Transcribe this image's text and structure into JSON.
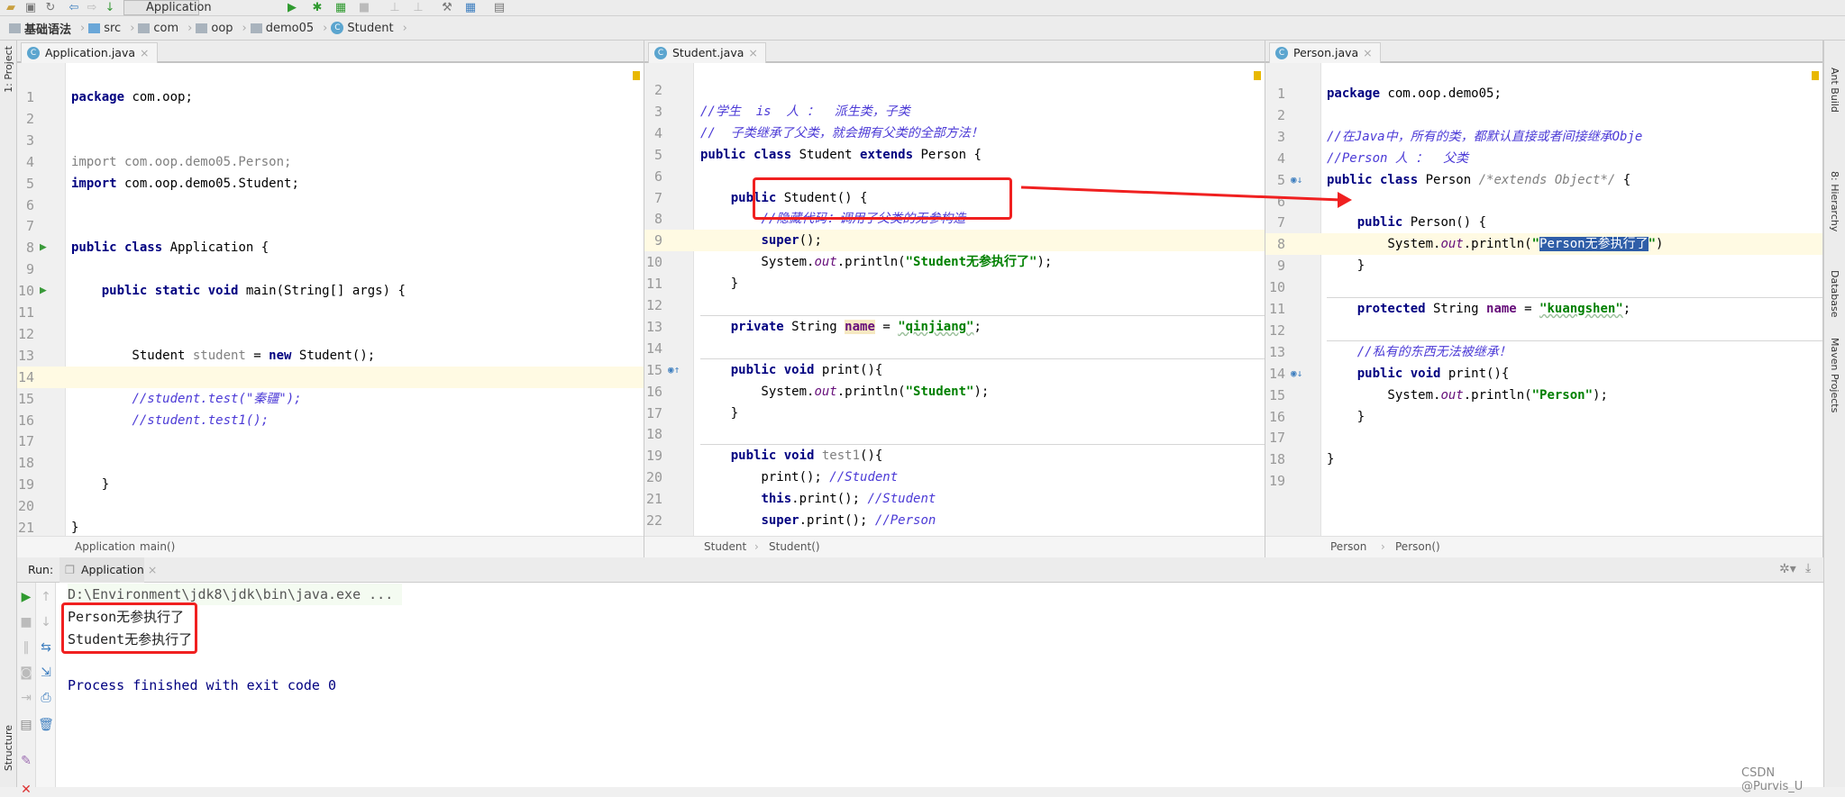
{
  "toolbar": {
    "run_config": "Application"
  },
  "breadcrumb": [
    "基础语法",
    "src",
    "com",
    "oop",
    "demo05",
    "Student"
  ],
  "left_strip": {
    "project": "1: Project",
    "structure": "Structure"
  },
  "right_strip": [
    "Ant Build",
    "8: Hierarchy",
    "Database",
    "Maven Projects"
  ],
  "panes": [
    {
      "tab": "Application.java",
      "start": 1,
      "current_line": 14,
      "footer": [
        "Application",
        "main()"
      ],
      "lines": [
        [
          [
            "k",
            "package"
          ],
          [
            "p",
            " com.oop;"
          ]
        ],
        [],
        [],
        [
          [
            "u",
            "import com.oop.demo05.Person;"
          ]
        ],
        [
          [
            "k",
            "import"
          ],
          [
            "p",
            " com.oop.demo05.Student;"
          ]
        ],
        [],
        [],
        [
          [
            "k",
            "public class"
          ],
          [
            "p",
            " Application {"
          ]
        ],
        [],
        [
          [
            "p",
            "    "
          ],
          [
            "k",
            "public static void"
          ],
          [
            "p",
            " main(String[] args) {"
          ]
        ],
        [],
        [],
        [
          [
            "p",
            "        Student "
          ],
          [
            "u",
            "student"
          ],
          [
            "p",
            " = "
          ],
          [
            "k",
            "new"
          ],
          [
            "p",
            " Student();"
          ]
        ],
        [],
        [
          [
            "p",
            "        "
          ],
          [
            "c",
            "//student.test(\"秦疆\");"
          ]
        ],
        [
          [
            "p",
            "        "
          ],
          [
            "c",
            "//student.test1();"
          ]
        ],
        [],
        [],
        [
          [
            "p",
            "    }"
          ]
        ],
        [],
        [
          [
            "p",
            "}"
          ]
        ]
      ]
    },
    {
      "tab": "Student.java",
      "start": 2,
      "current_line": 9,
      "footer": [
        "Student",
        "Student()"
      ],
      "lines": [
        [],
        [
          [
            "c",
            "//学生  is  人 ：  派生类，子类"
          ]
        ],
        [
          [
            "c",
            "//  子类继承了父类，就会拥有父类的全部方法！"
          ]
        ],
        [
          [
            "k",
            "public class"
          ],
          [
            "p",
            " Student "
          ],
          [
            "k",
            "extends"
          ],
          [
            "p",
            " Person {"
          ]
        ],
        [],
        [
          [
            "p",
            "    "
          ],
          [
            "k",
            "public"
          ],
          [
            "p",
            " Student() {"
          ]
        ],
        [
          [
            "p",
            "        "
          ],
          [
            "c",
            "//隐藏代码：调用了父类的无参构造"
          ]
        ],
        [
          [
            "p",
            "        "
          ],
          [
            "k",
            "super"
          ],
          [
            "p",
            "();"
          ]
        ],
        [
          [
            "p",
            "        System."
          ],
          [
            "o",
            "out"
          ],
          [
            "p",
            ".println("
          ],
          [
            "s",
            "\"Student无参执行了\""
          ],
          [
            "p",
            ");"
          ]
        ],
        [
          [
            "p",
            "    }"
          ]
        ],
        [],
        [
          [
            "p",
            "    "
          ],
          [
            "k",
            "private"
          ],
          [
            "p",
            " String "
          ],
          [
            "f hl",
            "name"
          ],
          [
            "p",
            " = "
          ],
          [
            "s",
            "\"qinjiang\""
          ],
          [
            "p",
            ";"
          ]
        ],
        [],
        [
          [
            "p",
            "    "
          ],
          [
            "k",
            "public void"
          ],
          [
            "p",
            " print(){"
          ]
        ],
        [
          [
            "p",
            "        System."
          ],
          [
            "o",
            "out"
          ],
          [
            "p",
            ".println("
          ],
          [
            "s",
            "\"Student\""
          ],
          [
            "p",
            ");"
          ]
        ],
        [
          [
            "p",
            "    }"
          ]
        ],
        [],
        [
          [
            "p",
            "    "
          ],
          [
            "k",
            "public void"
          ],
          [
            "u",
            " test1"
          ],
          [
            "p",
            "(){"
          ]
        ],
        [
          [
            "p",
            "        print(); "
          ],
          [
            "c",
            "//Student"
          ]
        ],
        [
          [
            "p",
            "        "
          ],
          [
            "k",
            "this"
          ],
          [
            "p",
            ".print(); "
          ],
          [
            "c",
            "//Student"
          ]
        ],
        [
          [
            "p",
            "        "
          ],
          [
            "k",
            "super"
          ],
          [
            "p",
            ".print(); "
          ],
          [
            "c",
            "//Person"
          ]
        ]
      ]
    },
    {
      "tab": "Person.java",
      "start": 1,
      "current_line": 8,
      "footer": [
        "Person",
        "Person()"
      ],
      "lines": [
        [
          [
            "k",
            "package"
          ],
          [
            "p",
            " com.oop.demo05;"
          ]
        ],
        [],
        [
          [
            "c",
            "//在Java中，所有的类，都默认直接或者间接继承Obje"
          ]
        ],
        [
          [
            "c",
            "//Person 人 ：  父类"
          ]
        ],
        [
          [
            "k",
            "public class"
          ],
          [
            "p",
            " Person "
          ],
          [
            "bc",
            "/*extends Object*/"
          ],
          [
            "p",
            " {"
          ]
        ],
        [],
        [
          [
            "p",
            "    "
          ],
          [
            "k",
            "public"
          ],
          [
            "p",
            " Person() {"
          ]
        ],
        [
          [
            "p",
            "        System."
          ],
          [
            "o",
            "out"
          ],
          [
            "p",
            ".println("
          ],
          [
            "s",
            "\""
          ],
          [
            "sel",
            "Person无参执行了"
          ],
          [
            "s",
            "\""
          ],
          [
            "p",
            ")"
          ]
        ],
        [
          [
            "p",
            "    }"
          ]
        ],
        [],
        [
          [
            "p",
            "    "
          ],
          [
            "k",
            "protected"
          ],
          [
            "p",
            " String "
          ],
          [
            "f",
            "name"
          ],
          [
            "p",
            " = "
          ],
          [
            "s",
            "\"kuangshen\""
          ],
          [
            "p",
            ";"
          ]
        ],
        [],
        [
          [
            "p",
            "    "
          ],
          [
            "c",
            "//私有的东西无法被继承！"
          ]
        ],
        [
          [
            "p",
            "    "
          ],
          [
            "k",
            "public void"
          ],
          [
            "p",
            " print(){"
          ]
        ],
        [
          [
            "p",
            "        System."
          ],
          [
            "o",
            "out"
          ],
          [
            "p",
            ".println("
          ],
          [
            "s",
            "\"Person\""
          ],
          [
            "p",
            ");"
          ]
        ],
        [
          [
            "p",
            "    }"
          ]
        ],
        [],
        [
          [
            "p",
            "}"
          ]
        ],
        []
      ]
    }
  ],
  "run": {
    "label": "Run:",
    "tab": "Application",
    "output": [
      "D:\\Environment\\jdk8\\jdk\\bin\\java.exe ...",
      "Person无参执行了",
      "Student无参执行了",
      "",
      "Process finished with exit code 0"
    ]
  },
  "watermark": "CSDN @Purvis_U",
  "colors": {
    "annotation": "#f02020",
    "keyword": "#000080",
    "string": "#008000",
    "comment": "#4b3ad6",
    "selection": "#2f5ea8"
  }
}
